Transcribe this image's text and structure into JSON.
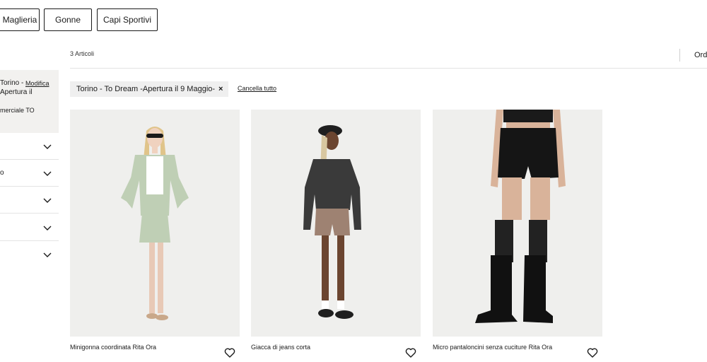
{
  "categories": [
    {
      "label": "Maglieria"
    },
    {
      "label": "Gonne"
    },
    {
      "label": "Capi Sportivi"
    }
  ],
  "store": {
    "line1": "Torino -",
    "modify_link": "Modifica",
    "line2": "Apertura il",
    "line3": "merciale TO"
  },
  "filters": [
    {
      "label": ""
    },
    {
      "label": "o"
    },
    {
      "label": ""
    },
    {
      "label": ""
    },
    {
      "label": ""
    }
  ],
  "toolbar": {
    "count": "3 Articoli",
    "sort_label": "Ord"
  },
  "active_filter": {
    "label": "Torino - To Dream -Apertura il 9 Maggio-",
    "remove_symbol": "×",
    "clear_all": "Cancella tutto"
  },
  "products": [
    {
      "name": "Minigonna coordinata Rita Ora"
    },
    {
      "name": "Giacca di jeans corta"
    },
    {
      "name": "Micro pantaloncini senza cuciture Rita Ora"
    }
  ],
  "colors": {
    "text": "#1a1a1a",
    "sidebar_bg": "#f2f1ef",
    "chip_bg": "#efefef",
    "image_bg": "#efefed"
  }
}
